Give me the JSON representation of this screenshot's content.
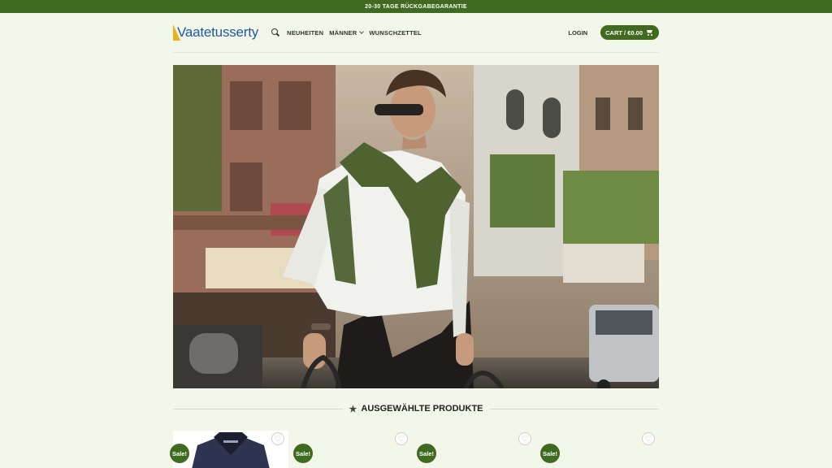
{
  "topbar": {
    "text": "20-30 TAGE RÜCKGABEGARANTIE"
  },
  "header": {
    "logo_text": "Vaatetusserty",
    "nav": [
      {
        "label": "NEUHEITEN"
      },
      {
        "label": "MÄNNER"
      },
      {
        "label": "WUNSCHZETTEL"
      }
    ],
    "login": "LOGIN",
    "cart": "CART / €0.00"
  },
  "section": {
    "title": "AUSGEWÄHLTE PRODUKTE"
  },
  "products": [
    {
      "badge": "Sale!",
      "wishlist_icon": "heart-icon"
    },
    {
      "badge": "Sale!",
      "wishlist_icon": "heart-icon"
    },
    {
      "badge": "Sale!",
      "wishlist_icon": "heart-icon"
    },
    {
      "badge": "Sale!",
      "wishlist_icon": "heart-icon"
    }
  ],
  "colors": {
    "brand_green": "#3f6a1f",
    "background": "#f2f7e9",
    "logo_blue": "#1f5aa0",
    "logo_accent": "#e7b21a"
  }
}
